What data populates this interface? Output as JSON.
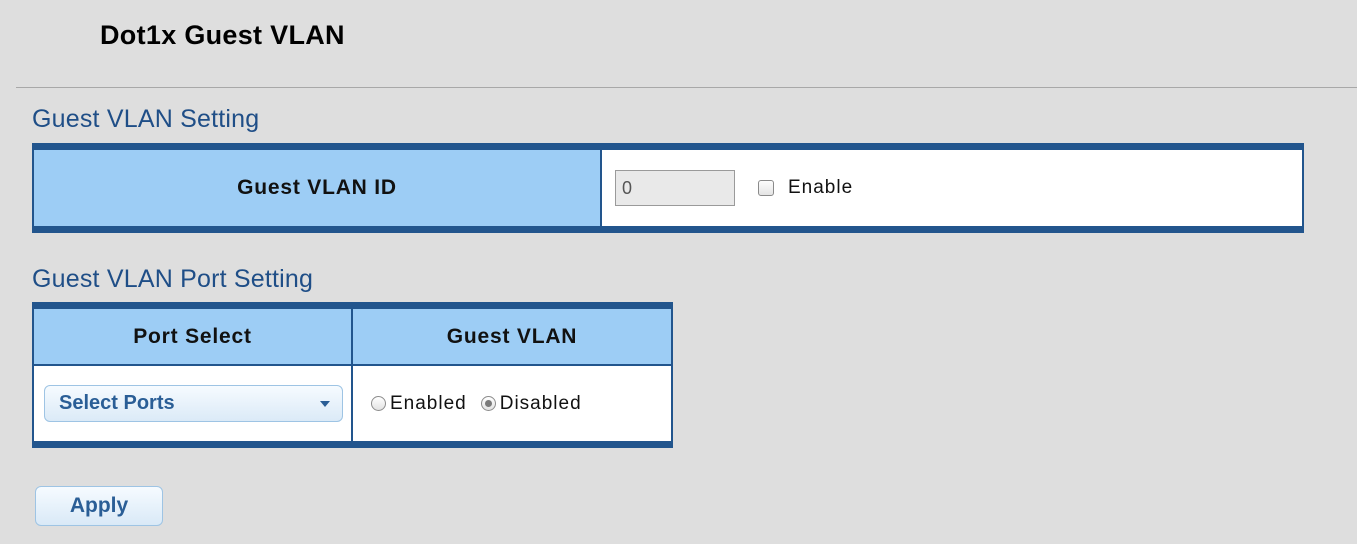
{
  "page": {
    "title": "Dot1x Guest VLAN"
  },
  "guest_vlan_setting": {
    "section_title": "Guest VLAN Setting",
    "label": "Guest VLAN ID",
    "vlan_id_value": "0",
    "enable_checked": false,
    "enable_label": "Enable"
  },
  "port_setting": {
    "section_title": "Guest VLAN Port Setting",
    "headers": [
      "Port Select",
      "Guest VLAN"
    ],
    "port_select_value": "Select Ports",
    "options": [
      {
        "label": "Enabled",
        "checked": false
      },
      {
        "label": "Disabled",
        "checked": true
      }
    ]
  },
  "actions": {
    "apply_label": "Apply"
  },
  "colors": {
    "table_border": "#22558d",
    "header_bg": "#9dcdf5",
    "section_title": "#1f4e87",
    "page_bg": "#dedede"
  }
}
